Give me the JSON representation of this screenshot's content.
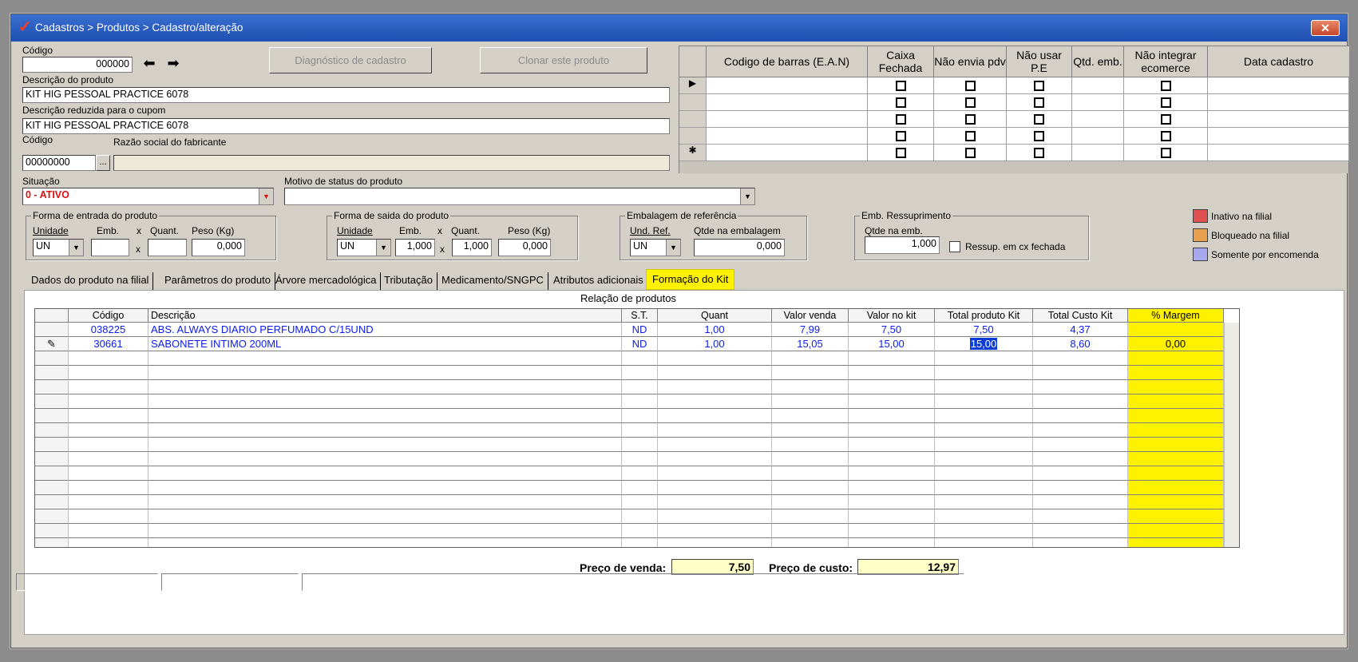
{
  "window": {
    "title": "Cadastros > Produtos > Cadastro/alteração",
    "close_label": "✕"
  },
  "header": {
    "codigo_label": "Código",
    "codigo_value": "000000",
    "diag_button": "Diagnóstico de cadastro",
    "clone_button": "Clonar este produto",
    "descricao_label": "Descrição  do produto",
    "descricao_value": "KIT HIG PESSOAL PRACTICE 6078",
    "descricao_red_label": "Descrição reduzida para o cupom",
    "descricao_red_value": "KIT HIG PESSOAL PRACTICE 6078",
    "fab_codigo_label": "Código",
    "fab_codigo_value": "00000000",
    "fab_lookup": "...",
    "razao_label": "Razão social do fabricante",
    "razao_value": "",
    "situacao_label": "Situação",
    "situacao_value": "0 - ATIVO",
    "motivo_label": "Motivo de status do produto",
    "motivo_value": ""
  },
  "ean_grid": {
    "columns": [
      "Codigo de barras (E.A.N)",
      "Caixa Fechada",
      "Não envia pdv",
      "Não usar P.E",
      "Qtd. emb.",
      "Não integrar ecomerce",
      "Data cadastro"
    ],
    "row_markers": [
      "▶",
      "",
      "",
      "",
      "✱"
    ]
  },
  "entrada": {
    "title": "Forma de entrada do produto",
    "unidade_label": "Unidade",
    "emb_label": "Emb.",
    "x": "x",
    "quant_label": "Quant.",
    "peso_label": "Peso (Kg)",
    "unidade": "UN",
    "emb": "",
    "quant": "",
    "peso": "0,000"
  },
  "saida": {
    "title": "Forma de saida do produto",
    "unidade_label": "Unidade",
    "emb_label": "Emb.",
    "x": "x",
    "quant_label": "Quant.",
    "peso_label": "Peso (Kg)",
    "unidade": "UN",
    "emb": "1,000",
    "quant": "1,000",
    "peso": "0,000"
  },
  "embref": {
    "title": "Embalagem de referência",
    "und_label": "Und. Ref.",
    "qtde_label": "Qtde na embalagem",
    "und": "UN",
    "qtde": "0,000"
  },
  "ressup": {
    "title": "Emb. Ressuprimento",
    "qtde_label": "Qtde na emb.",
    "qtde": "1,000",
    "check_label": "Ressup. em cx fechada"
  },
  "legend": [
    {
      "label": "Inativo na filial",
      "color": "#e05050"
    },
    {
      "label": "Bloqueado na filial",
      "color": "#e8a050"
    },
    {
      "label": "Somente por encomenda",
      "color": "#a8a8f0"
    }
  ],
  "tabs": [
    "Dados do produto na filial",
    "Parâmetros do produto",
    "Árvore mercadológica",
    "Tributação",
    "Medicamento/SNGPC",
    "Atributos adicionais",
    "Formação do Kit"
  ],
  "kit": {
    "section_title": "Relação de produtos",
    "columns": [
      "",
      "Código",
      "Descrição",
      "S.T.",
      "Quant",
      "Valor venda",
      "Valor no kit",
      "Total produto Kit",
      "Total Custo Kit",
      "% Margem"
    ],
    "rows": [
      {
        "marker": "",
        "codigo": "038225",
        "descricao": "ABS. ALWAYS DIARIO PERFUMADO C/15UND",
        "st": "ND",
        "quant": "1,00",
        "valor_venda": "7,99",
        "valor_kit": "7,50",
        "total_produto": "7,50",
        "total_custo": "4,37",
        "margem": ""
      },
      {
        "marker": "✎",
        "codigo": "30661",
        "descricao": "SABONETE INTIMO 200ML",
        "st": "ND",
        "quant": "1,00",
        "valor_venda": "15,05",
        "valor_kit": "15,00",
        "total_produto": "15,00",
        "total_custo": "8,60",
        "margem": "0,00"
      }
    ],
    "preco_venda_label": "Preço de venda:",
    "preco_venda": "7,50",
    "preco_custo_label": "Preço de custo:",
    "preco_custo": "12,97"
  }
}
